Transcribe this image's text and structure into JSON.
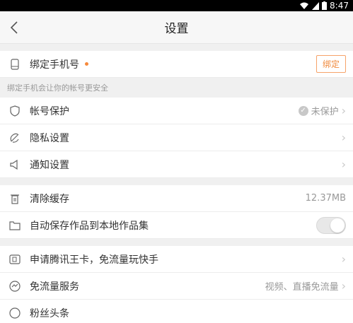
{
  "statusbar": {
    "time": "8:47"
  },
  "header": {
    "title": "设置"
  },
  "bind_phone": {
    "label": "绑定手机号",
    "button": "绑定"
  },
  "hint": "绑定手机会让你的帐号更安全",
  "account": [
    {
      "label": "帐号保护",
      "status": "未保护"
    },
    {
      "label": "隐私设置"
    },
    {
      "label": "通知设置"
    }
  ],
  "storage": {
    "clear_cache": {
      "label": "清除缓存",
      "value": "12.37MB"
    },
    "autosave": {
      "label": "自动保存作品到本地作品集",
      "on": false
    }
  },
  "services": [
    {
      "label": "申请腾讯王卡，免流量玩快手"
    },
    {
      "label": "免流量服务",
      "value": "视频、直播免流量"
    },
    {
      "label": "粉丝头条"
    }
  ],
  "colors": {
    "accent": "#f08a3c",
    "background": "#f2f2f2"
  }
}
